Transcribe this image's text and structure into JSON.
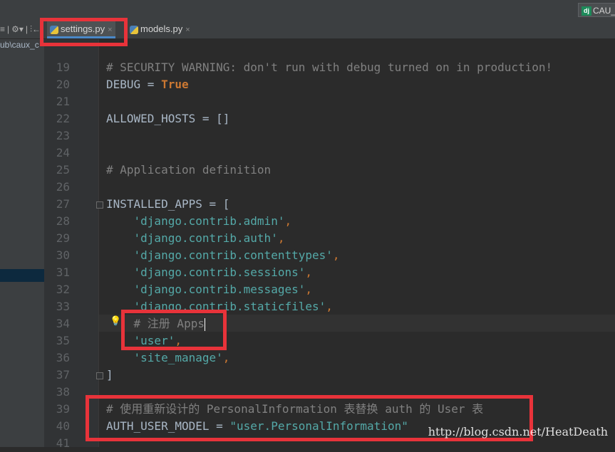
{
  "toolbar": {
    "tools": [
      "≡",
      "|",
      "⚙▾",
      "|",
      "⫶←"
    ],
    "run_config_label": "CAU_"
  },
  "tabs": [
    {
      "label": "settings.py",
      "close": "×",
      "active": true
    },
    {
      "label": "models.py",
      "close": "×",
      "active": false
    }
  ],
  "project": {
    "path_fragment": "ub\\caux_c"
  },
  "editor": {
    "lines": [
      {
        "n": "19",
        "parts": [
          {
            "t": "# SECURITY WARNING: don't run with debug turned on in production!",
            "c": "comment"
          }
        ]
      },
      {
        "n": "20",
        "parts": [
          {
            "t": "DEBUG = ",
            "c": ""
          },
          {
            "t": "True",
            "c": "kw"
          }
        ]
      },
      {
        "n": "21",
        "parts": []
      },
      {
        "n": "22",
        "parts": [
          {
            "t": "ALLOWED_HOSTS = []",
            "c": ""
          }
        ]
      },
      {
        "n": "23",
        "parts": []
      },
      {
        "n": "24",
        "parts": []
      },
      {
        "n": "25",
        "parts": [
          {
            "t": "# Application definition",
            "c": "comment"
          }
        ]
      },
      {
        "n": "26",
        "parts": []
      },
      {
        "n": "27",
        "parts": [
          {
            "t": "INSTALLED_APPS = [",
            "c": ""
          }
        ]
      },
      {
        "n": "28",
        "parts": [
          {
            "t": "    ",
            "c": ""
          },
          {
            "t": "'django.contrib.admin'",
            "c": "str2"
          },
          {
            "t": ",",
            "c": "kwp"
          }
        ]
      },
      {
        "n": "29",
        "parts": [
          {
            "t": "    ",
            "c": ""
          },
          {
            "t": "'django.contrib.auth'",
            "c": "str2"
          },
          {
            "t": ",",
            "c": "kwp"
          }
        ]
      },
      {
        "n": "30",
        "parts": [
          {
            "t": "    ",
            "c": ""
          },
          {
            "t": "'django.contrib.contenttypes'",
            "c": "str2"
          },
          {
            "t": ",",
            "c": "kwp"
          }
        ]
      },
      {
        "n": "31",
        "parts": [
          {
            "t": "    ",
            "c": ""
          },
          {
            "t": "'django.contrib.sessions'",
            "c": "str2"
          },
          {
            "t": ",",
            "c": "kwp"
          }
        ]
      },
      {
        "n": "32",
        "parts": [
          {
            "t": "    ",
            "c": ""
          },
          {
            "t": "'django.contrib.messages'",
            "c": "str2"
          },
          {
            "t": ",",
            "c": "kwp"
          }
        ]
      },
      {
        "n": "33",
        "parts": [
          {
            "t": "    ",
            "c": ""
          },
          {
            "t": "'django.contrib.staticfiles'",
            "c": "str2"
          },
          {
            "t": ",",
            "c": "kwp"
          }
        ]
      },
      {
        "n": "34",
        "parts": [
          {
            "t": "    ",
            "c": ""
          },
          {
            "t": "# 注册 Apps",
            "c": "comment"
          }
        ]
      },
      {
        "n": "35",
        "parts": [
          {
            "t": "    ",
            "c": ""
          },
          {
            "t": "'user'",
            "c": "str2"
          },
          {
            "t": ",",
            "c": "kwp"
          }
        ]
      },
      {
        "n": "36",
        "parts": [
          {
            "t": "    ",
            "c": ""
          },
          {
            "t": "'site_manage'",
            "c": "str2"
          },
          {
            "t": ",",
            "c": "kwp"
          }
        ]
      },
      {
        "n": "37",
        "parts": [
          {
            "t": "]",
            "c": ""
          }
        ]
      },
      {
        "n": "38",
        "parts": []
      },
      {
        "n": "39",
        "parts": [
          {
            "t": "# 使用重新设计的 PersonalInformation 表替换 auth 的 User 表",
            "c": "comment"
          }
        ]
      },
      {
        "n": "40",
        "parts": [
          {
            "t": "AUTH_USER_MODEL = ",
            "c": ""
          },
          {
            "t": "\"user.PersonalInformation\"",
            "c": "str2"
          }
        ]
      },
      {
        "n": "41",
        "parts": []
      }
    ]
  },
  "watermark": "http://blog.csdn.net/HeatDeath",
  "colors": {
    "highlight_box": "#e8333a",
    "comment": "#808080",
    "string": "#54a9a8",
    "keyword": "#cc7832"
  }
}
